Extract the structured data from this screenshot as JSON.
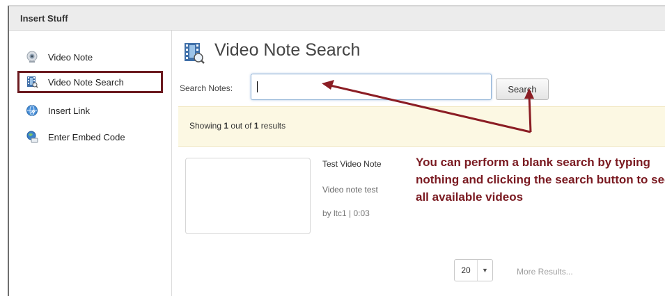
{
  "window": {
    "title": "Insert Stuff"
  },
  "sidebar": {
    "items": [
      {
        "label": "Video Note",
        "icon": "webcam-icon"
      },
      {
        "label": "Video Note Search",
        "icon": "film-search-icon"
      },
      {
        "label": "Insert Link",
        "icon": "globe-link-icon"
      },
      {
        "label": "Enter Embed Code",
        "icon": "embed-globe-icon"
      }
    ],
    "active_index": 1
  },
  "main": {
    "title": "Video Note Search",
    "title_icon": "film-search-icon",
    "search": {
      "label": "Search Notes:",
      "value": "",
      "button_label": "Search"
    },
    "results": {
      "prefix": "Showing ",
      "shown": "1",
      "middle": " out of ",
      "total": "1",
      "suffix": " results"
    },
    "items": [
      {
        "title": "Test Video Note",
        "description": "Video note test",
        "byline": "by ltc1 | 0:03"
      }
    ],
    "pager": {
      "page_size": "20",
      "more_label": "More Results..."
    }
  },
  "annotation": {
    "text": "You can perform a blank search by typing nothing and clicking the search button to see all available videos",
    "color": "#7a1a21"
  },
  "colors": {
    "highlight_border": "#6b1a1f",
    "results_bg": "#fcf8e3",
    "input_focus": "#8fb2d6"
  }
}
